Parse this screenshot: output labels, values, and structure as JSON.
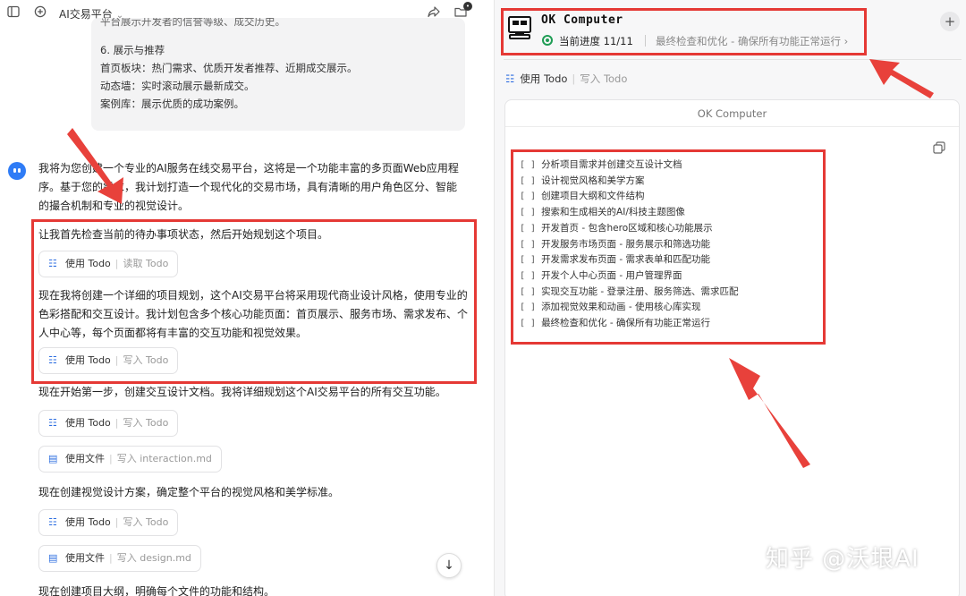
{
  "left": {
    "title": "AI交易平台",
    "message_box": {
      "cut_line": "平台展示开发者的信誉等级、成交历史。",
      "heading": "6. 展示与推荐",
      "lines": [
        "首页板块：热门需求、优质开发者推荐、近期成交展示。",
        "动态墙：实时滚动展示最新成交。",
        "案例库：展示优质的成功案例。"
      ]
    },
    "paragraphs": [
      "我将为您创建一个专业的AI服务在线交易平台，这将是一个功能丰富的多页面Web应用程序。基于您的需求，我计划打造一个现代化的交易市场，具有清晰的用户角色区分、智能的撮合机制和专业的视觉设计。",
      "让我首先检查当前的待办事项状态，然后开始规划这个项目。",
      "现在我将创建一个详细的项目规划，这个AI交易平台将采用现代商业设计风格，使用专业的色彩搭配和交互设计。我计划包含多个核心功能页面：首页展示、服务市场、需求发布、个人中心等，每个页面都将有丰富的交互功能和视觉效果。",
      "现在开始第一步，创建交互设计文档。我将详细规划这个AI交易平台的所有交互功能。",
      "现在创建视觉设计方案，确定整个平台的视觉风格和美学标准。",
      "现在创建项目大纲，明确每个文件的功能和结构。"
    ],
    "chips": [
      {
        "label": "使用 Todo",
        "sub": "读取 Todo"
      },
      {
        "label": "使用 Todo",
        "sub": "写入 Todo"
      },
      {
        "label": "使用 Todo",
        "sub": "写入 Todo"
      },
      {
        "label": "使用文件",
        "sub": "写入 interaction.md"
      },
      {
        "label": "使用 Todo",
        "sub": "写入 Todo"
      },
      {
        "label": "使用文件",
        "sub": "写入 design.md"
      }
    ]
  },
  "right": {
    "title": "OK Computer",
    "progress_label": "当前进度 11/11",
    "progress_task": "最终检查和优化 - 确保所有功能正常运行",
    "progress_chevron": "›",
    "tab_label": "使用 Todo",
    "tab_sub": "写入 Todo",
    "card_header": "OK Computer",
    "checkbox": "[ ]",
    "todos": [
      "分析项目需求并创建交互设计文档",
      "设计视觉风格和美学方案",
      "创建项目大纲和文件结构",
      "搜索和生成相关的AI/科技主题图像",
      "开发首页 - 包含hero区域和核心功能展示",
      "开发服务市场页面 - 服务展示和筛选功能",
      "开发需求发布页面 - 需求表单和匹配功能",
      "开发个人中心页面 - 用户管理界面",
      "实现交互功能 - 登录注册、服务筛选、需求匹配",
      "添加视觉效果和动画 - 使用核心库实现",
      "最终检查和优化 - 确保所有功能正常运行"
    ]
  },
  "watermark": "知乎 @沃垠AI",
  "colors": {
    "accent": "#2f6fe0",
    "annotation": "#e53935",
    "success": "#1f9d55"
  }
}
